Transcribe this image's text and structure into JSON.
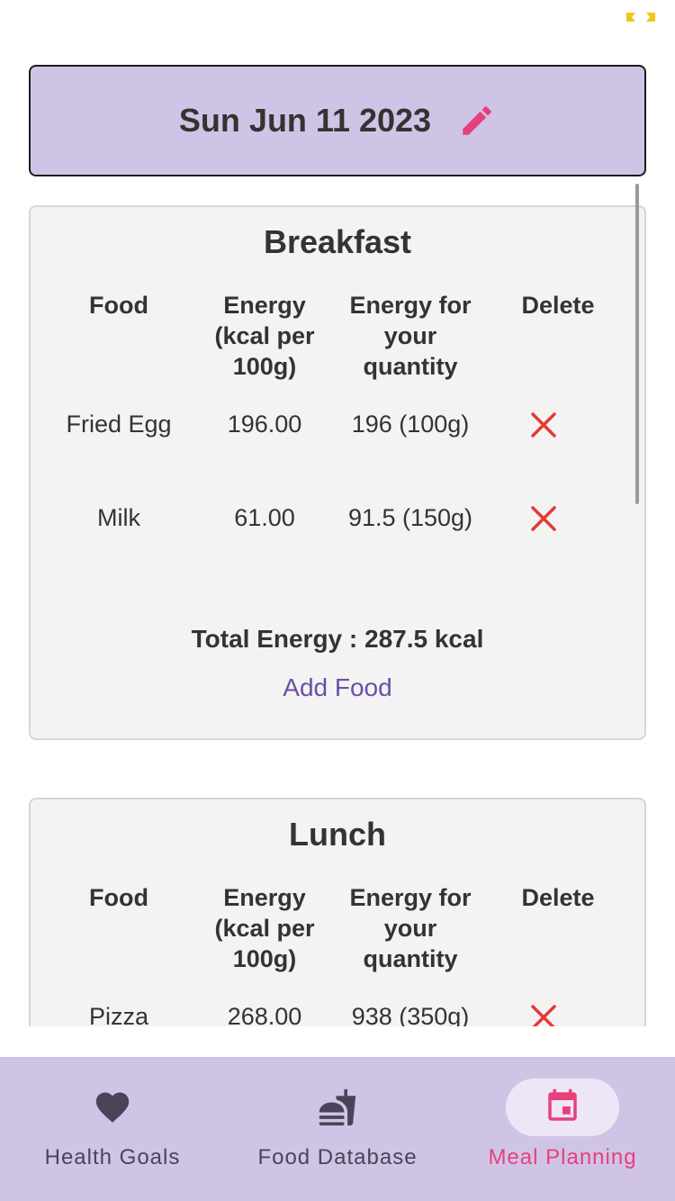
{
  "header": {
    "date": "Sun Jun 11 2023"
  },
  "table_headers": {
    "food": "Food",
    "energy_per_100g": "Energy (kcal per 100g)",
    "energy_quantity": "Energy for your quantity",
    "delete": "Delete"
  },
  "meals": [
    {
      "title": "Breakfast",
      "rows": [
        {
          "food": "Fried Egg",
          "energy": "196.00",
          "quantity_energy": "196 (100g)"
        },
        {
          "food": "Milk",
          "energy": "61.00",
          "quantity_energy": "91.5 (150g)"
        }
      ],
      "total": "Total Energy : 287.5 kcal",
      "add_label": "Add Food"
    },
    {
      "title": "Lunch",
      "rows": [
        {
          "food": "Pizza",
          "energy": "268.00",
          "quantity_energy": "938 (350g)"
        }
      ]
    }
  ],
  "nav": {
    "items": [
      {
        "label": "Health Goals",
        "icon": "heart-icon",
        "active": false
      },
      {
        "label": "Food Database",
        "icon": "fastfood-icon",
        "active": false
      },
      {
        "label": "Meal Planning",
        "icon": "calendar-icon",
        "active": true
      }
    ]
  },
  "colors": {
    "accent": "#e5417a",
    "header_bg": "#d0c4e6",
    "delete": "#e53935",
    "link": "#6a4fa8"
  }
}
